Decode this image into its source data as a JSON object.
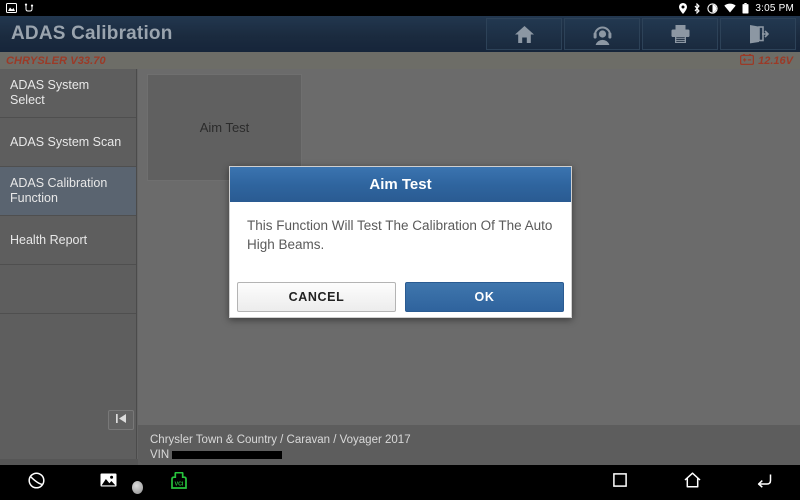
{
  "status_bar": {
    "left_icons": [
      "screenshot-icon",
      "usb-debug-icon"
    ],
    "right_icons": [
      "location-icon",
      "bluetooth-icon",
      "sync-rotate-icon",
      "wifi-icon",
      "battery-icon"
    ],
    "time": "3:05 PM"
  },
  "header": {
    "title": "ADAS Calibration",
    "actions": [
      {
        "name": "home-icon",
        "label": "Home"
      },
      {
        "name": "support-headset-icon",
        "label": "Support"
      },
      {
        "name": "printer-icon",
        "label": "Print"
      },
      {
        "name": "exit-icon",
        "label": "Exit"
      }
    ]
  },
  "subheader": {
    "brand_version": "CHRYSLER V33.70",
    "battery_icon": "battery-icon",
    "voltage": "12.16V"
  },
  "sidebar": {
    "items": [
      {
        "label": "ADAS System Select",
        "selected": false
      },
      {
        "label": "ADAS System Scan",
        "selected": false
      },
      {
        "label": "ADAS Calibration Function",
        "selected": true
      },
      {
        "label": "Health Report",
        "selected": false
      }
    ],
    "collapse_icon": "collapse-left-icon"
  },
  "content": {
    "tiles": [
      {
        "label": "Aim Test"
      }
    ]
  },
  "vehicle": {
    "description": "Chrysler Town & Country / Caravan / Voyager 2017",
    "vin_label": "VIN",
    "vin_value": ""
  },
  "dialog": {
    "title": "Aim Test",
    "message": "This Function Will Test The Calibration Of The Auto High Beams.",
    "cancel_label": "CANCEL",
    "ok_label": "OK"
  },
  "nav_bar": {
    "left": [
      {
        "name": "browser-icon"
      },
      {
        "name": "gallery-icon"
      },
      {
        "name": "vci-icon",
        "label": "VCI"
      }
    ],
    "right": [
      {
        "name": "recents-square-icon"
      },
      {
        "name": "home-outline-icon"
      },
      {
        "name": "back-arrow-icon"
      }
    ]
  },
  "colors": {
    "header_bg": "#1b2b3f",
    "accent_blue": "#2f659f",
    "brand_red": "#9b3a27",
    "body_gray": "#646464",
    "vci_green": "#27c43d"
  }
}
